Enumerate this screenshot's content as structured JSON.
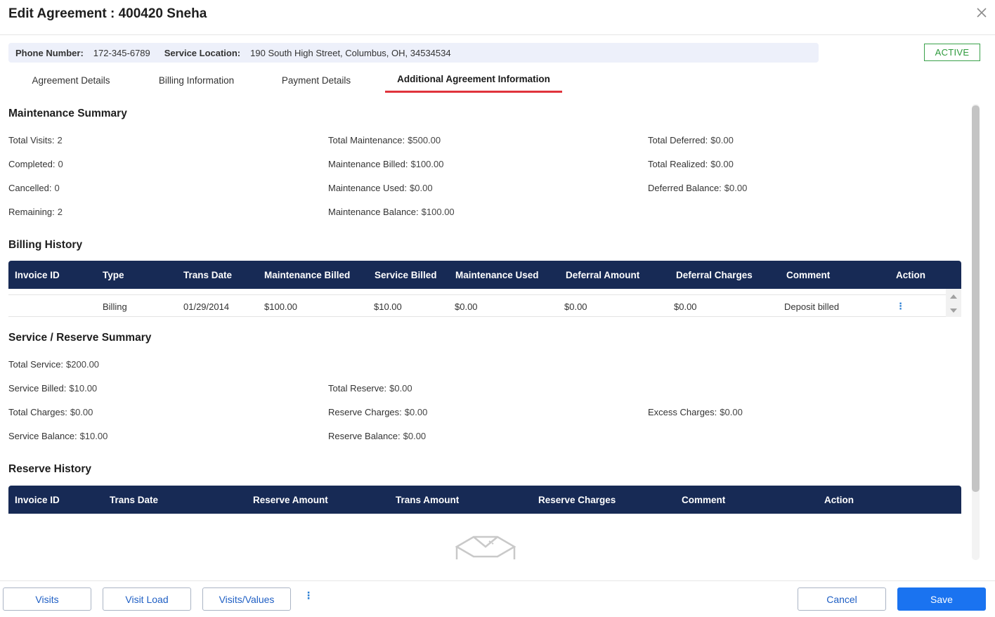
{
  "header": {
    "title": "Edit Agreement : 400420 Sneha",
    "close_icon": "close-icon"
  },
  "info": {
    "phone_label": "Phone Number:",
    "phone_value": "172-345-6789",
    "location_label": "Service Location:",
    "location_value": "190 South High Street, Columbus, OH, 34534534"
  },
  "status": {
    "label": "ACTIVE",
    "color": "#2e9a3c"
  },
  "tabs": [
    {
      "label": "Agreement Details"
    },
    {
      "label": "Billing Information"
    },
    {
      "label": "Payment Details"
    },
    {
      "label": "Additional Agreement Information"
    }
  ],
  "maintenance": {
    "title": "Maintenance Summary",
    "fields": [
      {
        "label": "Total Visits",
        "value": "2"
      },
      {
        "label": "Completed",
        "value": "0"
      },
      {
        "label": "Cancelled",
        "value": "0"
      },
      {
        "label": "Remaining",
        "value": "2"
      },
      {
        "label": "Total Maintenance",
        "value": "$500.00"
      },
      {
        "label": "Maintenance Billed",
        "value": "$100.00"
      },
      {
        "label": "Maintenance Used",
        "value": "$0.00"
      },
      {
        "label": "Maintenance Balance",
        "value": "$100.00"
      },
      {
        "label": "Total Deferred",
        "value": "$0.00"
      },
      {
        "label": "Total Realized",
        "value": "$0.00"
      },
      {
        "label": "Deferred Balance",
        "value": "$0.00"
      }
    ]
  },
  "billing_history": {
    "title": "Billing History",
    "columns": [
      "Invoice ID",
      "Type",
      "Trans Date",
      "Maintenance Billed",
      "Service Billed",
      "Maintenance Used",
      "Deferral Amount",
      "Deferral Charges",
      "Comment",
      "Action"
    ],
    "rows": [
      [
        "",
        "Billing",
        "01/29/2014",
        "$100.00",
        "$10.00",
        "$0.00",
        "$0.00",
        "$0.00",
        "Deposit billed",
        "⋮"
      ]
    ]
  },
  "service_reserve": {
    "title": "Service / Reserve Summary",
    "fields": [
      {
        "label": "Total Service",
        "value": "$200.00"
      },
      {
        "label": "Service Billed",
        "value": "$10.00"
      },
      {
        "label": "Total Charges",
        "value": "$0.00"
      },
      {
        "label": "Service Balance",
        "value": "$10.00"
      },
      {
        "label": "Total Reserve",
        "value": "$0.00"
      },
      {
        "label": "Reserve Charges",
        "value": "$0.00"
      },
      {
        "label": "Reserve Balance",
        "value": "$0.00"
      },
      {
        "label": "Excess Charges",
        "value": "$0.00"
      }
    ]
  },
  "reserve_history": {
    "title": "Reserve History",
    "columns": [
      "Invoice ID",
      "Trans Date",
      "Reserve Amount",
      "Trans Amount",
      "Reserve Charges",
      "Comment",
      "Action"
    ],
    "empty_icon": "empty-box-icon"
  },
  "footer": {
    "visits": "Visits",
    "visit_load": "Visit Load",
    "visits_values": "Visits/Values",
    "more": "⋮",
    "cancel": "Cancel",
    "save": "Save"
  }
}
